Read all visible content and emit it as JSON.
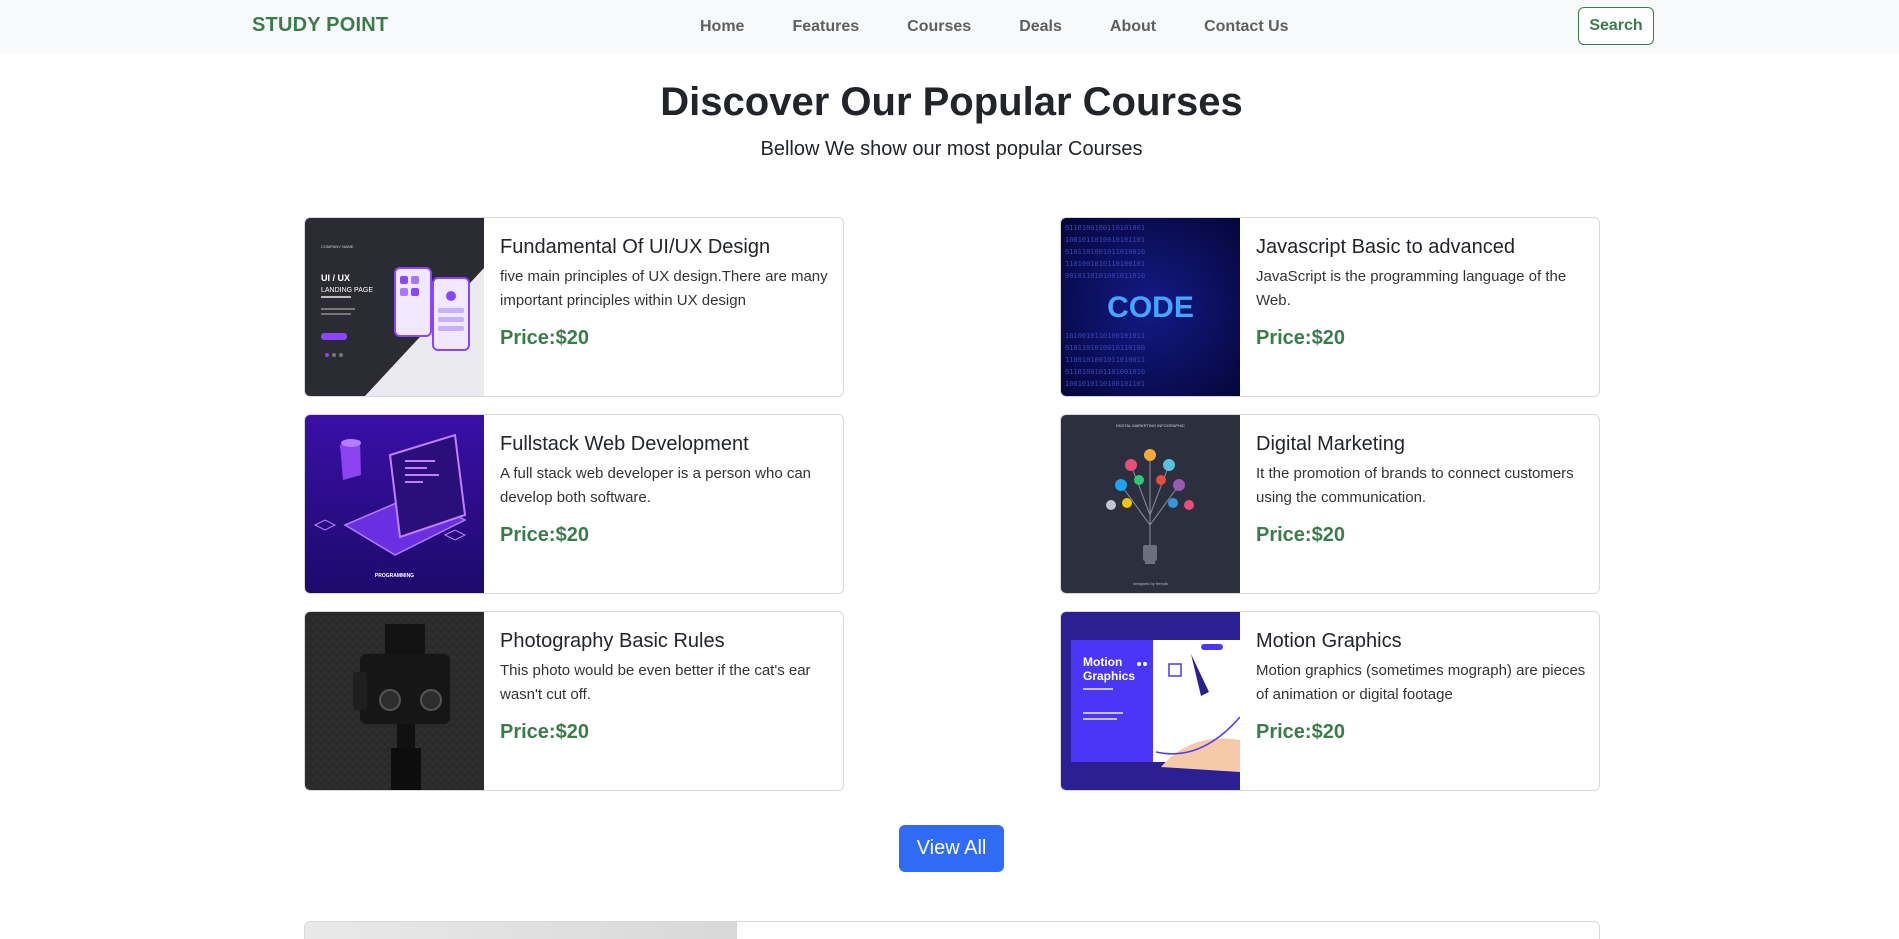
{
  "navbar": {
    "brand": "STUDY POINT",
    "links": [
      "Home",
      "Features",
      "Courses",
      "Deals",
      "About",
      "Contact Us"
    ],
    "search_label": "Search"
  },
  "section": {
    "title": "Discover Our Popular Courses",
    "subtitle": "Bellow We show our most popular Courses"
  },
  "courses": [
    {
      "title": "Fundamental Of UI/UX Design",
      "description": "five main principles of UX design.There are many important principles within UX design",
      "price": "Price:$20",
      "image_icon": "ui-ux-landing-page-thumbnail",
      "image_text": {
        "heading": "UI / UX",
        "sub": "LANDING PAGE",
        "brand": "COMPANY NAME"
      }
    },
    {
      "title": "Javascript Basic to advanced",
      "description": "JavaScript is the programming language of the Web.",
      "price": "Price:$20",
      "image_icon": "code-binary-thumbnail",
      "image_text": {
        "heading": "CODE"
      }
    },
    {
      "title": "Fullstack Web Development",
      "description": "A full stack web developer is a person who can develop both software.",
      "price": "Price:$20",
      "image_icon": "isometric-laptop-thumbnail",
      "image_text": {
        "caption": "PROGRAMMING"
      }
    },
    {
      "title": "Digital Marketing",
      "description": "It the promotion of brands to connect customers using the communication.",
      "price": "Price:$20",
      "image_icon": "lightbulb-social-icons-thumbnail",
      "image_text": {
        "heading": "DIGITAL MARKETING INFOGRAPHIC",
        "credit": "designed by freepik"
      }
    },
    {
      "title": "Photography Basic Rules",
      "description": "This photo would be even better if the cat's ear wasn't cut off.",
      "price": "Price:$20",
      "image_icon": "camera-on-tripod-thumbnail"
    },
    {
      "title": "Motion Graphics",
      "description": "Motion graphics (sometimes mograph) are pieces of animation or digital footage",
      "price": "Price:$20",
      "image_icon": "motion-graphics-hand-thumbnail",
      "image_text": {
        "line1": "Motion",
        "line2": "Graphics"
      }
    }
  ],
  "view_all_label": "View All",
  "colors": {
    "brand_green": "#3b7d4a",
    "primary_blue": "#2f6bf5",
    "navbar_bg": "#f8f9fa"
  }
}
